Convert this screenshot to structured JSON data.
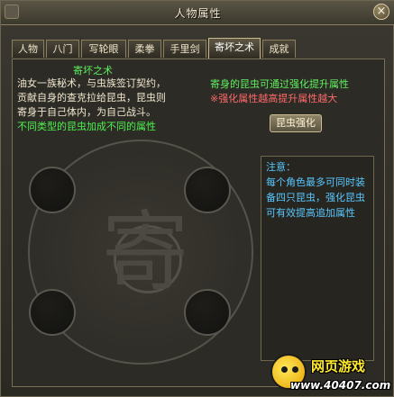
{
  "window": {
    "title": "人物属性",
    "close_glyph": "×"
  },
  "tabs": [
    {
      "label": "人物",
      "active": false
    },
    {
      "label": "八门",
      "active": false
    },
    {
      "label": "写轮眼",
      "active": false
    },
    {
      "label": "柔拳",
      "active": false
    },
    {
      "label": "手里剑",
      "active": false
    },
    {
      "label": "寄坏之术",
      "active": true
    },
    {
      "label": "成就",
      "active": false
    }
  ],
  "skill": {
    "title": "寄坏之术",
    "description_lines": [
      "油女一族秘术，与虫族签订契约，",
      "贡献自身的查克拉给昆虫，昆虫则",
      "寄身于自己体内，为自己战斗。"
    ],
    "description_green": "不同类型的昆虫加成不同的属性"
  },
  "info": {
    "line1": "寄身的昆虫可通过强化提升属性",
    "line2": "※强化属性越高提升属性越大"
  },
  "buttons": {
    "strengthen": "昆虫强化"
  },
  "note": {
    "title": "注意：",
    "lines": [
      "每个角色最多可同时装",
      "备四只昆虫，强化昆虫",
      "可有效提高追加属性"
    ]
  },
  "seal": {
    "char": "寄"
  },
  "watermark": {
    "text": "网页游戏",
    "url": "www.40407.com"
  },
  "colors": {
    "green_text": "#5ff05f",
    "red_text": "#ff6a6a",
    "note_text": "#58c8ff",
    "body_text": "#f1e7cf"
  },
  "icons": [
    "close-icon",
    "watermark-logo-icon"
  ]
}
